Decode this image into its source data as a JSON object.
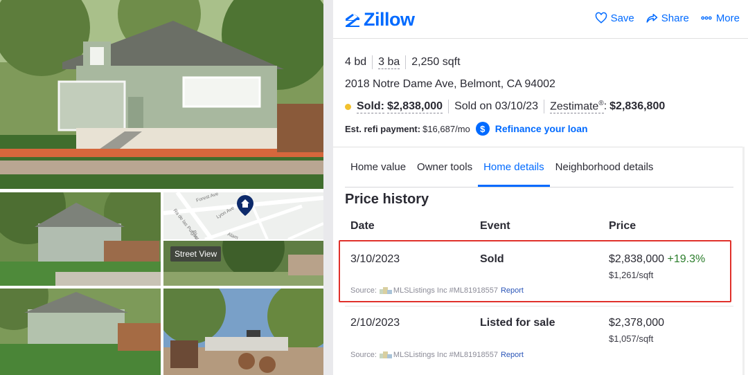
{
  "header": {
    "logo_text": "Zillow",
    "actions": [
      {
        "label": "Save",
        "icon": "heart-icon"
      },
      {
        "label": "Share",
        "icon": "share-icon"
      },
      {
        "label": "More",
        "icon": "more-dots-icon"
      }
    ]
  },
  "gallery": {
    "street_view_label": "Street View",
    "map_labels": [
      "Forest Ave",
      "Lyon Ave",
      "Alam",
      "Ra de las Pulgas",
      "Blvd"
    ]
  },
  "listing": {
    "beds": "4 bd",
    "baths": "3 ba",
    "sqft": "2,250 sqft",
    "address": "2018 Notre Dame Ave, Belmont, CA 94002",
    "status_label": "Sold:",
    "sold_price": "$2,838,000",
    "sold_on": "Sold on 03/10/23",
    "zestimate_label": "Zestimate",
    "zestimate_mark": "®",
    "zestimate_colon": ":",
    "zestimate_value": "$2,836,800",
    "refi_label": "Est. refi payment:",
    "refi_value": "$16,687/mo",
    "refi_link": "Refinance your loan"
  },
  "tabs": [
    {
      "label": "Home value",
      "active": false
    },
    {
      "label": "Owner tools",
      "active": false
    },
    {
      "label": "Home details",
      "active": true
    },
    {
      "label": "Neighborhood details",
      "active": false
    }
  ],
  "price_history": {
    "title": "Price history",
    "columns": [
      "Date",
      "Event",
      "Price"
    ],
    "rows": [
      {
        "date": "3/10/2023",
        "event": "Sold",
        "price": "$2,838,000",
        "change": "+19.3%",
        "per_sqft": "$1,261/sqft",
        "source_label": "Source:",
        "source": "MLSListings Inc #ML81918557",
        "report": "Report"
      },
      {
        "date": "2/10/2023",
        "event": "Listed for sale",
        "price": "$2,378,000",
        "change": "",
        "per_sqft": "$1,057/sqft",
        "source_label": "Source:",
        "source": "MLSListings Inc #ML81918557",
        "report": "Report"
      }
    ]
  },
  "colors": {
    "brand": "#006aff",
    "sold_dot": "#f2c12e",
    "change_positive": "#2b7d2b",
    "highlight": "#e0302a"
  }
}
